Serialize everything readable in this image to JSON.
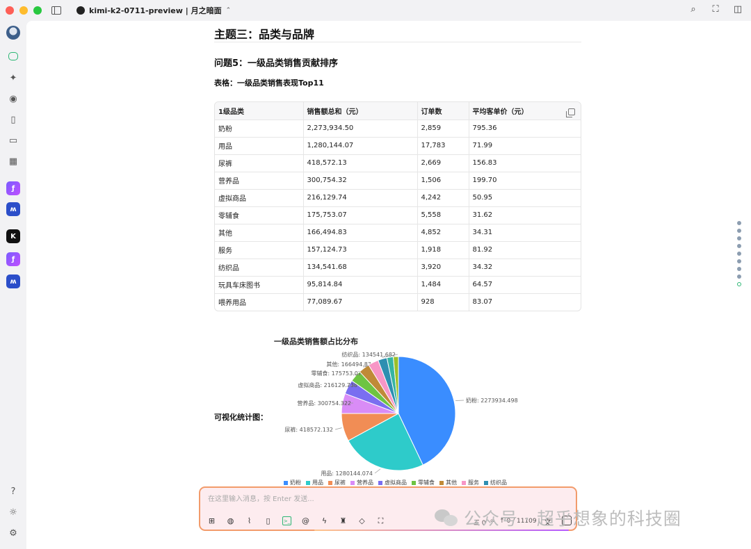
{
  "window": {
    "title": "kimi-k2-0711-preview | 月之暗面",
    "title_chevron": "⌃"
  },
  "content": {
    "heading": "主题三：品类与品牌",
    "question": "问题5：一级品类销售贡献排序",
    "table_caption": "表格：一级品类销售表现Top11",
    "table": {
      "headers": [
        "1级品类",
        "销售额总和（元）",
        "订单数",
        "平均客单价（元）"
      ],
      "rows": [
        [
          "奶粉",
          "2,273,934.50",
          "2,859",
          "795.36"
        ],
        [
          "用品",
          "1,280,144.07",
          "17,783",
          "71.99"
        ],
        [
          "尿裤",
          "418,572.13",
          "2,669",
          "156.83"
        ],
        [
          "营养品",
          "300,754.32",
          "1,506",
          "199.70"
        ],
        [
          "虚拟商品",
          "216,129.74",
          "4,242",
          "50.95"
        ],
        [
          "零辅食",
          "175,753.07",
          "5,558",
          "31.62"
        ],
        [
          "其他",
          "166,494.83",
          "4,852",
          "34.31"
        ],
        [
          "服务",
          "157,124.73",
          "1,918",
          "81.92"
        ],
        [
          "纺织品",
          "134,541.68",
          "3,920",
          "34.32"
        ],
        [
          "玩具车床图书",
          "95,814.84",
          "1,484",
          "64.57"
        ],
        [
          "喂养用品",
          "77,089.67",
          "928",
          "83.07"
        ]
      ]
    },
    "viz_label": "可视化统计图："
  },
  "chart_data": {
    "type": "pie",
    "title": "一级品类销售额占比分布",
    "categories": [
      "奶粉",
      "用品",
      "尿裤",
      "营养品",
      "虚拟商品",
      "零辅食",
      "其他",
      "服务",
      "纺织品",
      "玩具车床图书",
      "喂养用品"
    ],
    "values": [
      2273934.498,
      1280144.074,
      418572.132,
      300754.322,
      216129.738,
      175753.072,
      166494.834,
      157124.73,
      134541.682,
      95814.84,
      77089.67
    ],
    "slice_labels": [
      "奶粉: 2273934.498",
      "用品: 1280144.074",
      "尿裤: 418572.132",
      "营养品: 300754.322",
      "虚拟商品: 216129.738",
      "零辅食: 175753.072",
      "其他: 166494.834",
      "",
      "纺织品: 134541.682",
      "",
      ""
    ],
    "legend_visible": [
      "奶粉",
      "用品",
      "尿裤",
      "营养品",
      "虚拟商品",
      "零辅食",
      "其他",
      "服务",
      "纺织品"
    ],
    "colors": [
      "#3a8dff",
      "#2ecbca",
      "#f18d55",
      "#d98cf6",
      "#7a6ef0",
      "#6ec442",
      "#c08a37",
      "#f796c6",
      "#2e8fb1",
      "#36b4a3",
      "#9bbf2a"
    ],
    "legend_placement": "bottom"
  },
  "input": {
    "placeholder": "在这里输入消息，按 Enter 发送...",
    "counter_left": "三 0",
    "counter_mid": "∞",
    "counter_right": "↑ 0 / 11109"
  },
  "watermark": {
    "text": "公众号 · 超乎想象的科技圈"
  }
}
